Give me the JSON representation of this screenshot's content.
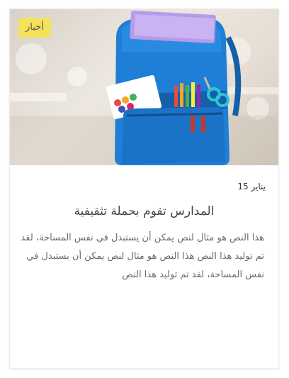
{
  "post": {
    "category": "أخبار",
    "date": "يناير 15",
    "title": "المدارس تقوم بحملة تثقيفية",
    "excerpt": "هذا النص هو مثال لنص يمكن أن يستبدل في نفس المساحة، لقد تم توليد هذا النص هذا النص هو مثال لنص يمكن أن يستبدل في نفس المساحة، لقد تم توليد هذا النص"
  },
  "colors": {
    "badge": "#f4e35a",
    "backpack": "#1f7fd6",
    "title_text": "#444444",
    "body_text": "#6a6a6a"
  }
}
